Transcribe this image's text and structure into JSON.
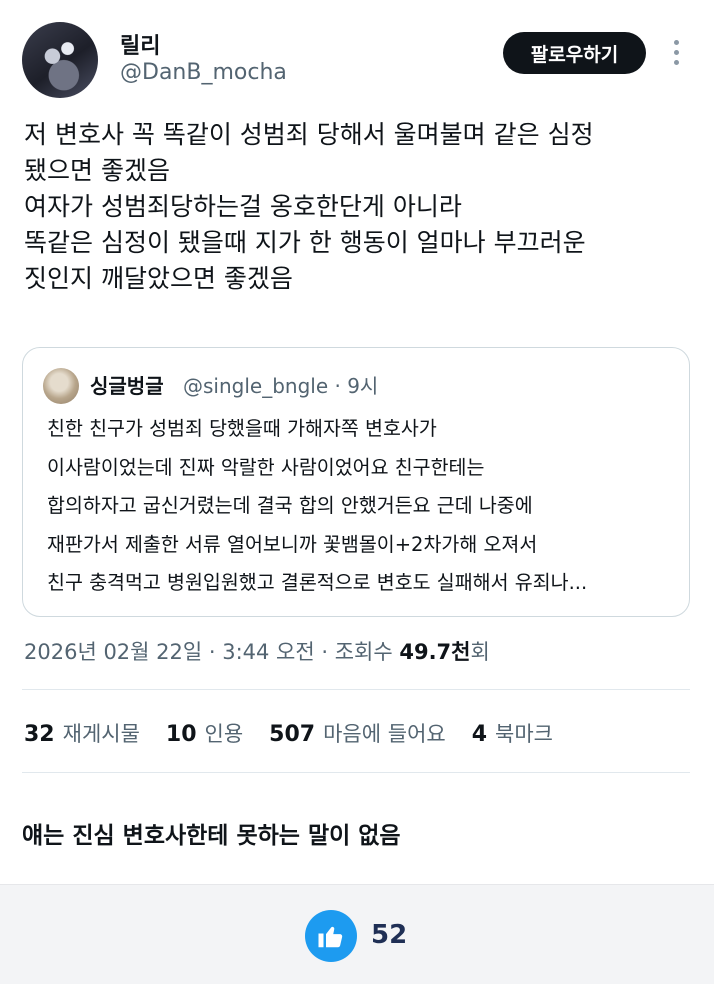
{
  "profile": {
    "display_name": "릴리",
    "handle": "@DanB_mocha",
    "follow_label": "팔로우하기"
  },
  "tweet": {
    "lines": [
      "저 변호사 꼭 똑같이 성범죄 당해서 울며불며 같은 심정",
      "됐으면 좋겠음",
      "여자가 성범죄당하는걸 옹호한단게 아니라",
      "똑같은 심정이 됐을때 지가 한 행동이 얼마나 부끄러운",
      "짓인지 깨달았으면 좋겠음"
    ]
  },
  "quote": {
    "name": "싱글벙글",
    "meta": "@single_bngle · 9시",
    "lines": [
      "친한 친구가 성범죄 당했을때 가해자쪽 변호사가",
      "이사람이었는데 진짜 악랄한 사람이었어요 친구한테는",
      "합의하자고 굽신거렸는데 결국 합의 안했거든요 근데 나중에",
      "재판가서 제출한 서류 열어보니까 꽃뱀몰이+2차가해 오져서",
      "친구 충격먹고 병원입원했고 결론적으로 변호도 실패해서 유죄나..."
    ]
  },
  "timestamp": {
    "prefix": "2026년 02월 22일 · 3:44 오전 · 조회수 ",
    "views": "49.7천",
    "suffix": "회"
  },
  "stats": {
    "retweets": "32",
    "retweets_label": "재게시물",
    "quotes": "10",
    "quotes_label": "인용",
    "likes": "507",
    "likes_label": "마음에 들어요",
    "bookmarks": "4",
    "bookmarks_label": "북마크"
  },
  "comment": "얘는 진심 변호사한테 못하는 말이 없음",
  "footer": {
    "like_count": "52"
  },
  "colors": {
    "accent": "#1d9bf0",
    "text": "#0f1419",
    "secondary": "#536471"
  }
}
